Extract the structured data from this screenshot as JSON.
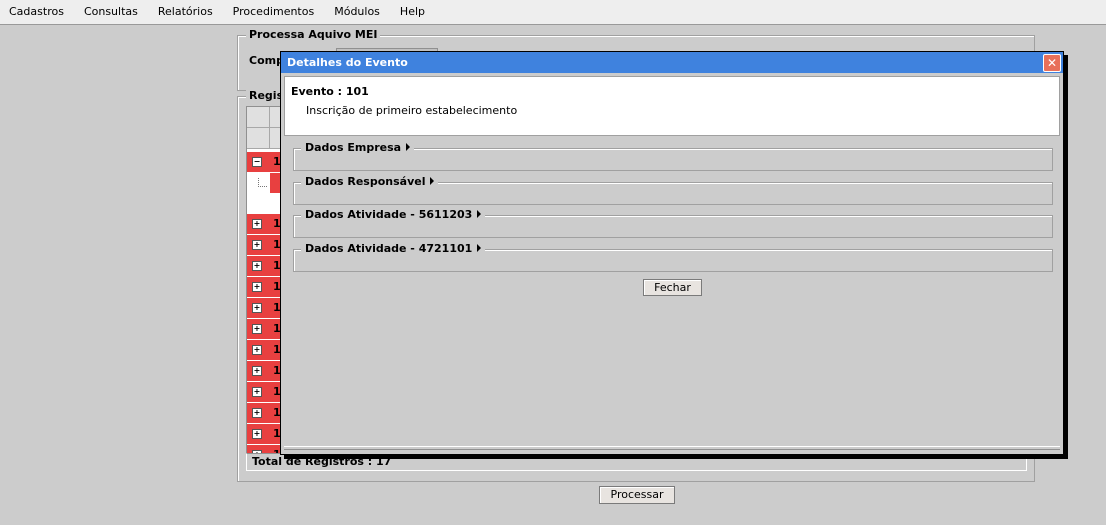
{
  "menu": [
    "Cadastros",
    "Consultas",
    "Relatórios",
    "Procedimentos",
    "Módulos",
    "Help"
  ],
  "background": {
    "panel_title": "Processa Aquivo MEI",
    "competencia_label": "Comp",
    "registros_label": "Regis",
    "rows": [
      {
        "expander": "−",
        "num": "1"
      },
      {
        "expander": "+",
        "num": "1"
      },
      {
        "expander": "+",
        "num": "1"
      },
      {
        "expander": "+",
        "num": "1"
      },
      {
        "expander": "+",
        "num": "1"
      },
      {
        "expander": "+",
        "num": "1"
      },
      {
        "expander": "+",
        "num": "1"
      },
      {
        "expander": "+",
        "num": "1"
      },
      {
        "expander": "+",
        "num": "1"
      },
      {
        "expander": "+",
        "num": "1"
      },
      {
        "expander": "+",
        "num": "1"
      },
      {
        "expander": "+",
        "num": "1"
      },
      {
        "expander": "+",
        "num": "1"
      }
    ],
    "total_text": "Total de Registros : 17",
    "process_button": "Processar"
  },
  "dialog": {
    "title": "Detalhes do Evento",
    "close_icon": "close-icon",
    "event_title": "Evento : 101",
    "event_description": "Inscrição de primeiro estabelecimento",
    "sections": [
      {
        "label": "Dados Empresa"
      },
      {
        "label": "Dados Responsável"
      },
      {
        "label": "Dados Atividade - 5611203"
      },
      {
        "label": "Dados Atividade - 4721101"
      }
    ],
    "close_button": "Fechar"
  },
  "colors": {
    "background": "#cccccc",
    "titlebar": "#3f82de",
    "row_highlight": "#e84040",
    "close_button": "#e8705a"
  }
}
